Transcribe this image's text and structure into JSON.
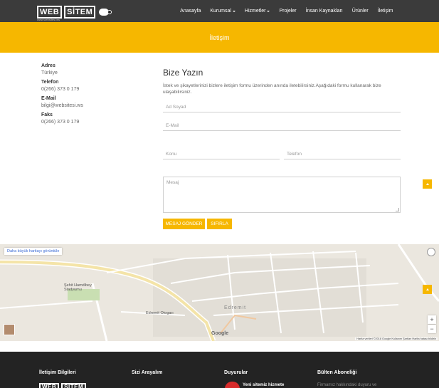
{
  "header": {
    "logo_part1": "WEB",
    "logo_part2": "SİTEM",
    "logo_tagline": "www.websitesi.ws",
    "nav": [
      {
        "label": "Anasayfa",
        "dropdown": false
      },
      {
        "label": "Kurumsal",
        "dropdown": true
      },
      {
        "label": "Hizmetler",
        "dropdown": true
      },
      {
        "label": "Projeler",
        "dropdown": false
      },
      {
        "label": "İnsan Kaynakları",
        "dropdown": false
      },
      {
        "label": "Ürünler",
        "dropdown": false
      },
      {
        "label": "İletişim",
        "dropdown": false
      }
    ]
  },
  "page_title": "İletişim",
  "contact": {
    "address_label": "Adres",
    "address_value": "Türkiye",
    "phone_label": "Telefon",
    "phone_value": "0(266) 373 0 179",
    "email_label": "E-Mail",
    "email_value": "bilgi@websitesi.ws",
    "fax_label": "Faks",
    "fax_value": "0(266) 373 0 179"
  },
  "form": {
    "title": "Bize Yazın",
    "description": "İstek ve şikayetlerinizi bizlere iletişim formu üzerinden anında iletebilirsiniz.Aşağıdaki formu kullanarak bize ulaşabilirsiniz.",
    "name_placeholder": "Ad Soyad",
    "email_placeholder": "E-Mail",
    "subject_placeholder": "Konu",
    "phone_placeholder": "Telefon",
    "message_placeholder": "Mesaj",
    "send_label": "MESAJ GÖNDER",
    "reset_label": "SIFIRLA"
  },
  "map": {
    "larger_map_link": "Daha büyük haritayı görüntüle",
    "stadium_label": "Şehit Hamdibey Stadyumu",
    "bus_label": "Edremit Otogarı",
    "city_label": "Edremit",
    "google_label": "Google",
    "footer_text": "Harita verileri ©2018 Google   Kullanım Şartları   Harita hatası bildirin",
    "zoom_in": "+",
    "zoom_out": "−"
  },
  "footer": {
    "col1_title": "İletişim Bilgileri",
    "col2_title": "Sizi Arayalım",
    "col3_title": "Duyurular",
    "col3_item": "Yeni sitemiz hizmete",
    "col4_title": "Bülten Aboneliği",
    "col4_text": "Firmamız hakkındaki duyuru ve"
  },
  "colors": {
    "accent": "#f6b700",
    "header_bg": "#3b3b3b",
    "footer_bg": "#232323"
  }
}
